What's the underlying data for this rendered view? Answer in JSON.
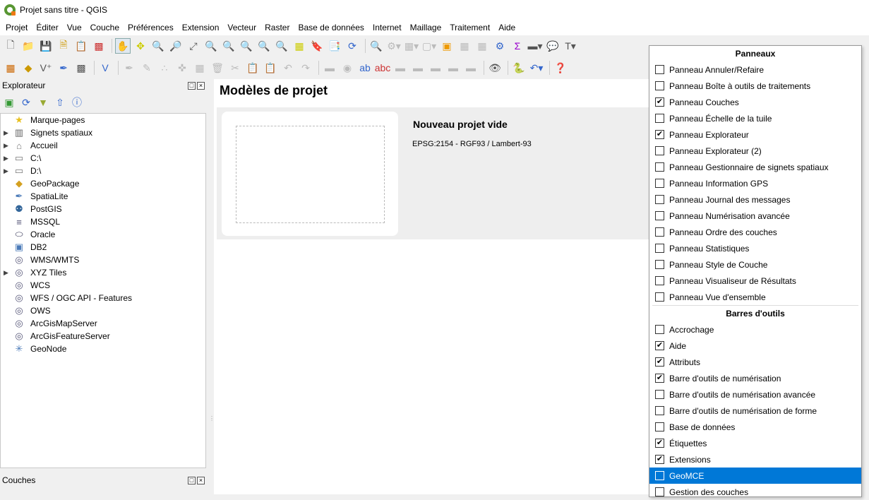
{
  "window": {
    "title": "Projet sans titre - QGIS"
  },
  "menubar": [
    "Projet",
    "Éditer",
    "Vue",
    "Couche",
    "Préférences",
    "Extension",
    "Vecteur",
    "Raster",
    "Base de données",
    "Internet",
    "Maillage",
    "Traitement",
    "Aide"
  ],
  "explorer": {
    "title": "Explorateur",
    "items": [
      {
        "label": "Marque-pages",
        "icon": "star-icon",
        "expandable": false
      },
      {
        "label": "Signets spatiaux",
        "icon": "spatial-bookmarks-icon",
        "expandable": true
      },
      {
        "label": "Accueil",
        "icon": "home-folder-icon",
        "expandable": true
      },
      {
        "label": "C:\\",
        "icon": "drive-icon",
        "expandable": true
      },
      {
        "label": "D:\\",
        "icon": "drive-icon",
        "expandable": true
      },
      {
        "label": "GeoPackage",
        "icon": "geopackage-icon",
        "expandable": false
      },
      {
        "label": "SpatiaLite",
        "icon": "spatialite-icon",
        "expandable": false
      },
      {
        "label": "PostGIS",
        "icon": "postgis-icon",
        "expandable": false
      },
      {
        "label": "MSSQL",
        "icon": "mssql-icon",
        "expandable": false
      },
      {
        "label": "Oracle",
        "icon": "oracle-icon",
        "expandable": false
      },
      {
        "label": "DB2",
        "icon": "db2-icon",
        "expandable": false
      },
      {
        "label": "WMS/WMTS",
        "icon": "globe-icon",
        "expandable": false
      },
      {
        "label": "XYZ Tiles",
        "icon": "globe-icon",
        "expandable": true
      },
      {
        "label": "WCS",
        "icon": "globe-icon",
        "expandable": false
      },
      {
        "label": "WFS / OGC API - Features",
        "icon": "wfs-icon",
        "expandable": false
      },
      {
        "label": "OWS",
        "icon": "globe-icon",
        "expandable": false
      },
      {
        "label": "ArcGisMapServer",
        "icon": "globe-icon",
        "expandable": false
      },
      {
        "label": "ArcGisFeatureServer",
        "icon": "globe-icon",
        "expandable": false
      },
      {
        "label": "GeoNode",
        "icon": "geonode-icon",
        "expandable": false
      }
    ]
  },
  "layers": {
    "title": "Couches"
  },
  "main": {
    "title": "Modèles de projet",
    "template": {
      "name": "Nouveau projet vide",
      "crs": "EPSG:2154 - RGF93 / Lambert-93"
    }
  },
  "context_menu": {
    "panels_header": "Panneaux",
    "panels": [
      {
        "label": "Panneau Annuler/Refaire",
        "checked": false
      },
      {
        "label": "Panneau Boîte à outils de traitements",
        "checked": false
      },
      {
        "label": "Panneau Couches",
        "checked": true
      },
      {
        "label": "Panneau Échelle de la tuile",
        "checked": false
      },
      {
        "label": "Panneau Explorateur",
        "checked": true
      },
      {
        "label": "Panneau Explorateur (2)",
        "checked": false
      },
      {
        "label": "Panneau Gestionnaire de signets spatiaux",
        "checked": false
      },
      {
        "label": "Panneau Information GPS",
        "checked": false
      },
      {
        "label": "Panneau Journal des messages",
        "checked": false
      },
      {
        "label": "Panneau Numérisation avancée",
        "checked": false
      },
      {
        "label": "Panneau Ordre des couches",
        "checked": false
      },
      {
        "label": "Panneau Statistiques",
        "checked": false
      },
      {
        "label": "Panneau Style de Couche",
        "checked": false
      },
      {
        "label": "Panneau Visualiseur de Résultats",
        "checked": false
      },
      {
        "label": "Panneau Vue d'ensemble",
        "checked": false
      }
    ],
    "toolbars_header": "Barres d'outils",
    "toolbars": [
      {
        "label": "Accrochage",
        "checked": false
      },
      {
        "label": "Aide",
        "checked": true
      },
      {
        "label": "Attributs",
        "checked": true
      },
      {
        "label": "Barre d'outils de numérisation",
        "checked": true
      },
      {
        "label": "Barre d'outils de numérisation avancée",
        "checked": false
      },
      {
        "label": "Barre d'outils de numérisation de forme",
        "checked": false
      },
      {
        "label": "Base de données",
        "checked": false
      },
      {
        "label": "Étiquettes",
        "checked": true
      },
      {
        "label": "Extensions",
        "checked": true
      },
      {
        "label": "GeoMCE",
        "checked": false,
        "highlighted": true
      },
      {
        "label": "Gestion des couches",
        "checked": false
      }
    ]
  },
  "colors": {
    "highlight": "#0078d7",
    "qgis_green": "#589632"
  }
}
